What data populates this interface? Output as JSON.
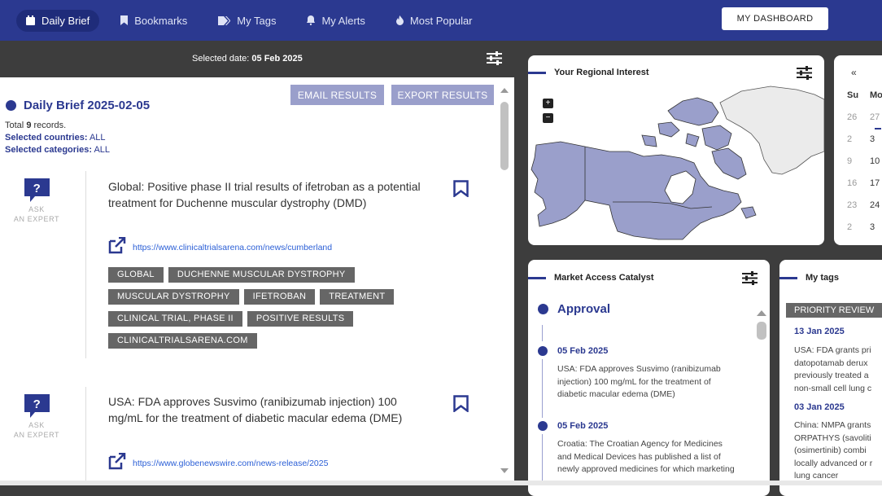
{
  "nav": {
    "items": [
      {
        "label": "Daily Brief",
        "icon": "calendar-icon"
      },
      {
        "label": "Bookmarks",
        "icon": "bookmark-icon"
      },
      {
        "label": "My Tags",
        "icon": "tags-icon"
      },
      {
        "label": "My Alerts",
        "icon": "bell-icon"
      },
      {
        "label": "Most Popular",
        "icon": "fire-icon"
      }
    ],
    "dashboard_button": "MY DASHBOARD"
  },
  "date_bar": {
    "label": "Selected date:",
    "value": "05 Feb 2025"
  },
  "brief": {
    "email_button": "EMAIL RESULTS",
    "export_button": "EXPORT RESULTS",
    "title": "Daily Brief 2025-02-05",
    "total_prefix": "Total",
    "total_count": "9",
    "total_suffix": "records.",
    "countries_label": "Selected countries:",
    "countries_value": "ALL",
    "categories_label": "Selected categories:",
    "categories_value": "ALL",
    "ask_line1": "ASK",
    "ask_line2": "AN EXPERT",
    "articles": [
      {
        "title": "Global: Positive phase II trial results of ifetroban as a potential treatment for Duchenne muscular dystrophy (DMD)",
        "link": "https://www.clinicaltrialsarena.com/news/cumberland",
        "tags": [
          "GLOBAL",
          "DUCHENNE MUSCULAR DYSTROPHY",
          "MUSCULAR DYSTROPHY",
          "IFETROBAN",
          "TREATMENT",
          "CLINICAL TRIAL, PHASE II",
          "POSITIVE RESULTS",
          "CLINICALTRIALSARENA.COM"
        ]
      },
      {
        "title": "USA: FDA approves Susvimo (ranibizumab injection) 100 mg/mL for the treatment of diabetic macular edema (DME)",
        "link": "https://www.globenewswire.com/news-release/2025"
      }
    ]
  },
  "regional": {
    "title": "Your Regional Interest",
    "zoom_in": "+",
    "zoom_out": "−"
  },
  "calendar": {
    "prev": "«",
    "day_headers": [
      "Su",
      "Mo"
    ],
    "rows": [
      [
        "26",
        "27"
      ],
      [
        "2",
        "3"
      ],
      [
        "9",
        "10"
      ],
      [
        "16",
        "17"
      ],
      [
        "23",
        "24"
      ],
      [
        "2",
        "3"
      ]
    ]
  },
  "market_access": {
    "title": "Market Access Catalyst",
    "section": "Approval",
    "entries": [
      {
        "date": "05 Feb 2025",
        "text": "USA: FDA approves Susvimo (ranibizumab injection) 100 mg/mL for the treatment of diabetic macular edema (DME)"
      },
      {
        "date": "05 Feb 2025",
        "text": "Croatia: The Croatian Agency for Medicines and Medical Devices has published a list of newly approved medicines for which marketing"
      }
    ]
  },
  "my_tags": {
    "title": "My tags",
    "tag": "PRIORITY REVIEW",
    "entries": [
      {
        "date": "13 Jan 2025",
        "text": "USA: FDA grants pri\ndatopotamab derux\npreviously treated a\nnon-small cell lung c"
      },
      {
        "date": "03 Jan 2025",
        "text": "China: NMPA grants\nORPATHYS (savoliti\n(osimertinib) combi\nlocally advanced or r\nlung cancer"
      }
    ]
  },
  "colors": {
    "brand": "#2b3990",
    "map_fill": "#9a9fcb",
    "tag_bg": "#666666"
  }
}
